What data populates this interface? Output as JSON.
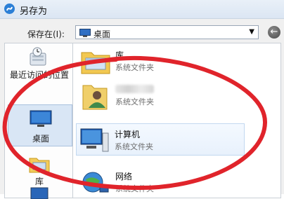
{
  "window": {
    "title": "另存为"
  },
  "location": {
    "label": "保存在(I):",
    "value": "桌面"
  },
  "places": [
    {
      "id": "recent",
      "label": "最近访问的位置"
    },
    {
      "id": "desktop",
      "label": "桌面",
      "selected": true
    },
    {
      "id": "library",
      "label": "库"
    }
  ],
  "files": [
    {
      "name": "库",
      "type": "系统文件夹",
      "icon": "library-folder-icon"
    },
    {
      "name": "",
      "type": "系统文件夹",
      "icon": "user-folder-icon",
      "name_obscured": true
    },
    {
      "name": "计算机",
      "type": "系统文件夹",
      "icon": "computer-icon",
      "highlighted": true
    },
    {
      "name": "网络",
      "type": "系统文件夹",
      "icon": "network-icon"
    }
  ],
  "colors": {
    "annotation": "#e0242b",
    "selection": "#d9e6f5"
  }
}
